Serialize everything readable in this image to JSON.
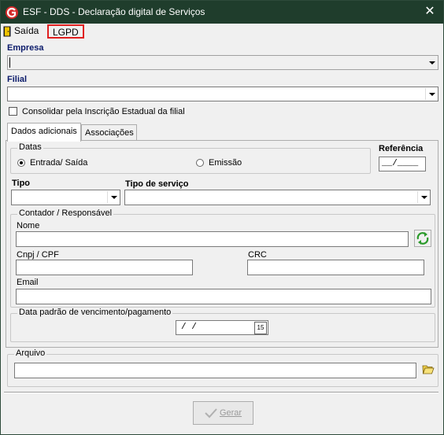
{
  "window": {
    "title": "ESF - DDS - Declaração digital de Serviços",
    "close_glyph": "✕"
  },
  "menu": {
    "saida": "Saída",
    "lgpd": "LGPD"
  },
  "form": {
    "empresa_label": "Empresa",
    "filial_label": "Filial",
    "consolidar_label": "Consolidar pela Inscrição Estadual da filial"
  },
  "tabs": [
    {
      "label": "Dados adicionais"
    },
    {
      "label": "Associações"
    }
  ],
  "datas": {
    "title": "Datas",
    "entrada_saida": "Entrada/ Saída",
    "emissao": "Emissão"
  },
  "referencia": {
    "label": "Referência",
    "mask": "__/____"
  },
  "tipo": {
    "label": "Tipo"
  },
  "tipo_servico": {
    "label": "Tipo de serviço"
  },
  "contador": {
    "title": "Contador / Responsável",
    "nome": "Nome",
    "cnpj": "Cnpj / CPF",
    "crc": "CRC",
    "email": "Email"
  },
  "vencimento": {
    "title": "Data padrão de vencimento/pagamento",
    "mask": "/  /",
    "calendar_day": "15"
  },
  "arquivo": {
    "title": "Arquivo"
  },
  "buttons": {
    "gerar": "Gerar"
  },
  "icons": {
    "app": "app-logo-icon",
    "refresh": "refresh-icon",
    "folder": "folder-open-icon",
    "check": "check-icon",
    "door": "exit-door-icon"
  }
}
